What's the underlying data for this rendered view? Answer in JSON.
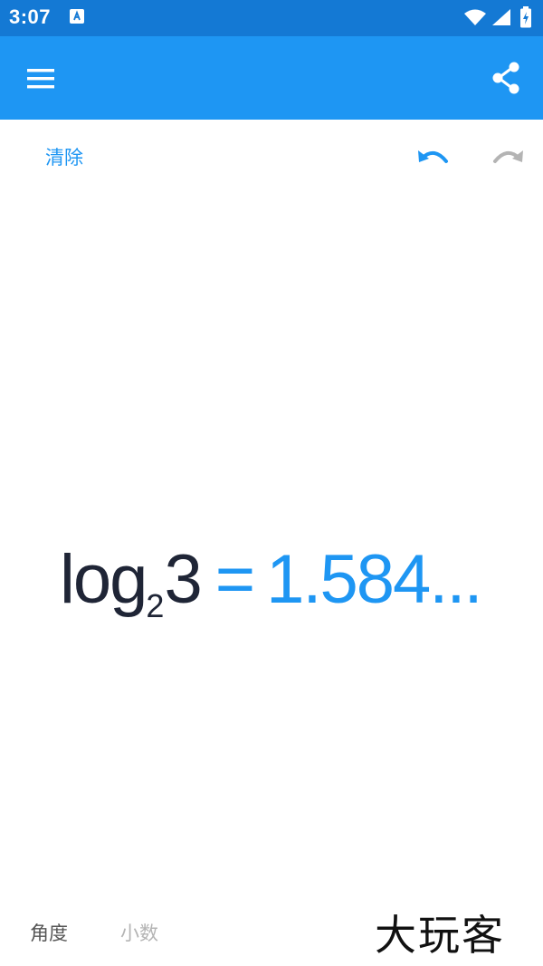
{
  "status_bar": {
    "time": "3:07",
    "notification_icon": "app-notification-icon",
    "icons": [
      "wifi-icon",
      "cell-signal-icon",
      "battery-charging-icon"
    ]
  },
  "app_bar": {
    "background_color": "#1e96f3",
    "status_bar_color": "#1479d4",
    "menu_icon": "hamburger-menu-icon",
    "share_icon": "share-icon"
  },
  "toolbar": {
    "clear_label": "清除",
    "undo_icon": "undo-icon",
    "redo_icon": "redo-icon",
    "undo_enabled": true,
    "redo_enabled": false
  },
  "expression": {
    "log_text": "log",
    "base": "2",
    "argument": "3",
    "equals": "=",
    "result": "1.584..."
  },
  "bottom_bar": {
    "angle_mode_label": "角度",
    "decimal_mode_label": "小数",
    "decimal_mode_active": false
  },
  "watermark": {
    "text": "大玩客"
  },
  "colors": {
    "accent": "#1e96f3",
    "expression_text": "#1f2536",
    "disabled": "#b4b4b4"
  }
}
